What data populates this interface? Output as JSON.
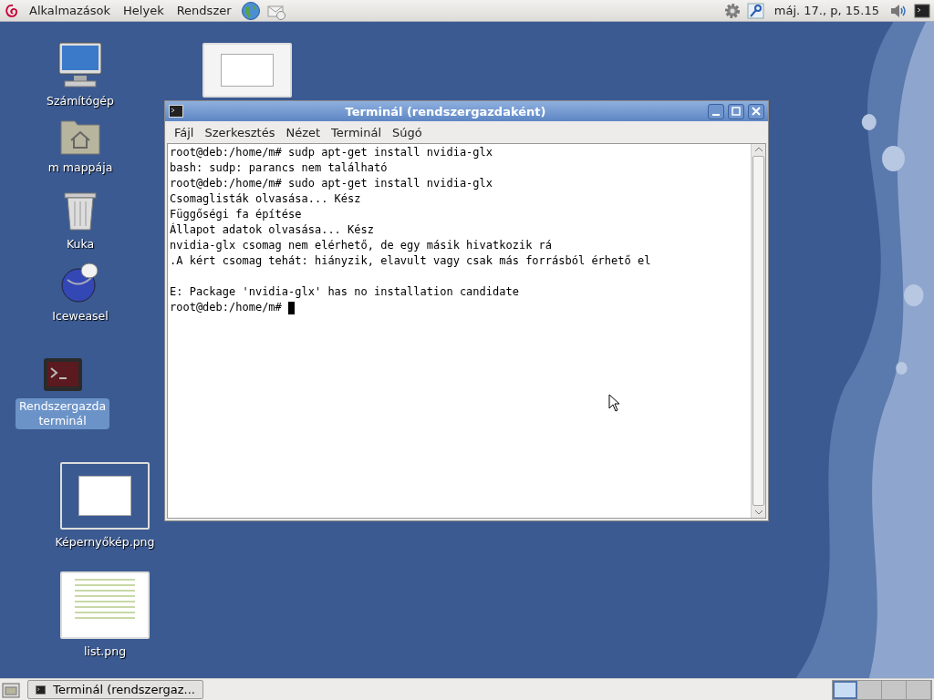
{
  "top_panel": {
    "menus": [
      "Alkalmazások",
      "Helyek",
      "Rendszer"
    ],
    "clock": "máj. 17., p, 15.15"
  },
  "desktop_icons": [
    {
      "kind": "image"
    },
    {
      "kind": "computer",
      "label": "Számítógép",
      "selected": false
    },
    {
      "kind": "home",
      "label": "m mappája",
      "selected": false
    },
    {
      "kind": "trash",
      "label": "Kuka",
      "selected": false
    },
    {
      "kind": "browser",
      "label": "Iceweasel",
      "selected": false
    },
    {
      "kind": "terminal",
      "label": "Rendszergazda terminál",
      "selected": true
    },
    {
      "kind": "image",
      "label": "Képernyőkép.png",
      "selected": false
    },
    {
      "kind": "document",
      "label": "list.png",
      "selected": false
    }
  ],
  "terminal": {
    "title": "Terminál (rendszergazdaként)",
    "menu": [
      "Fájl",
      "Szerkesztés",
      "Nézet",
      "Terminál",
      "Súgó"
    ],
    "lines": [
      {
        "kind": "text",
        "text": "root@deb:/home/m# sudp apt-get install nvidia-glx"
      },
      {
        "kind": "text",
        "text": "bash: sudp: parancs nem található"
      },
      {
        "kind": "text",
        "text": "root@deb:/home/m# sudo apt-get install nvidia-glx"
      },
      {
        "kind": "text",
        "text": "Csomaglisták olvasása... Kész"
      },
      {
        "kind": "text",
        "text": "Függőségi fa építése"
      },
      {
        "kind": "text",
        "text": "Állapot adatok olvasása... Kész"
      },
      {
        "kind": "text",
        "text": "nvidia-glx csomag nem elérhető, de egy másik hivatkozik rá"
      },
      {
        "kind": "text",
        "text": ".A kért csomag tehát: hiányzik, elavult vagy csak más forrásból érhető el"
      },
      {
        "kind": "blank"
      },
      {
        "kind": "text",
        "text": "E: Package 'nvidia-glx' has no installation candidate"
      },
      {
        "kind": "text",
        "text": "root@deb:/home/m#",
        "cursor": true
      }
    ]
  },
  "taskbar": {
    "windows": [
      {
        "label": "Terminál (rendszergaz...",
        "selected": false
      }
    ],
    "workspaces": [
      {
        "selected": true
      },
      {
        "selected": false
      },
      {
        "selected": false
      },
      {
        "selected": false
      }
    ]
  }
}
